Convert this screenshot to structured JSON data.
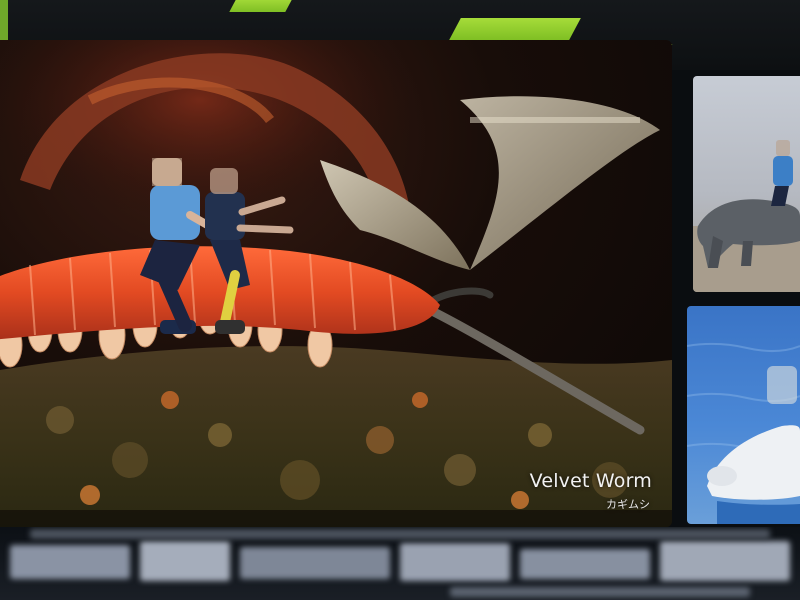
{
  "display": {
    "accent_color": "#9ad234",
    "background_color": "#07090c"
  },
  "main_panel": {
    "subject_name": "Velvet Worm",
    "subject_name_japanese": "カギムシ",
    "scene": "two people composited riding on a giant orange velvet worm crawling over moss",
    "faces": "pixelated"
  },
  "side_panels": [
    {
      "scene": "person riding a Komodo dragon on sand",
      "faces": "pixelated"
    },
    {
      "scene": "polar bear in blue water",
      "faces": "pixelated"
    }
  ],
  "ticker": {
    "state": "pixelated / illegible"
  }
}
